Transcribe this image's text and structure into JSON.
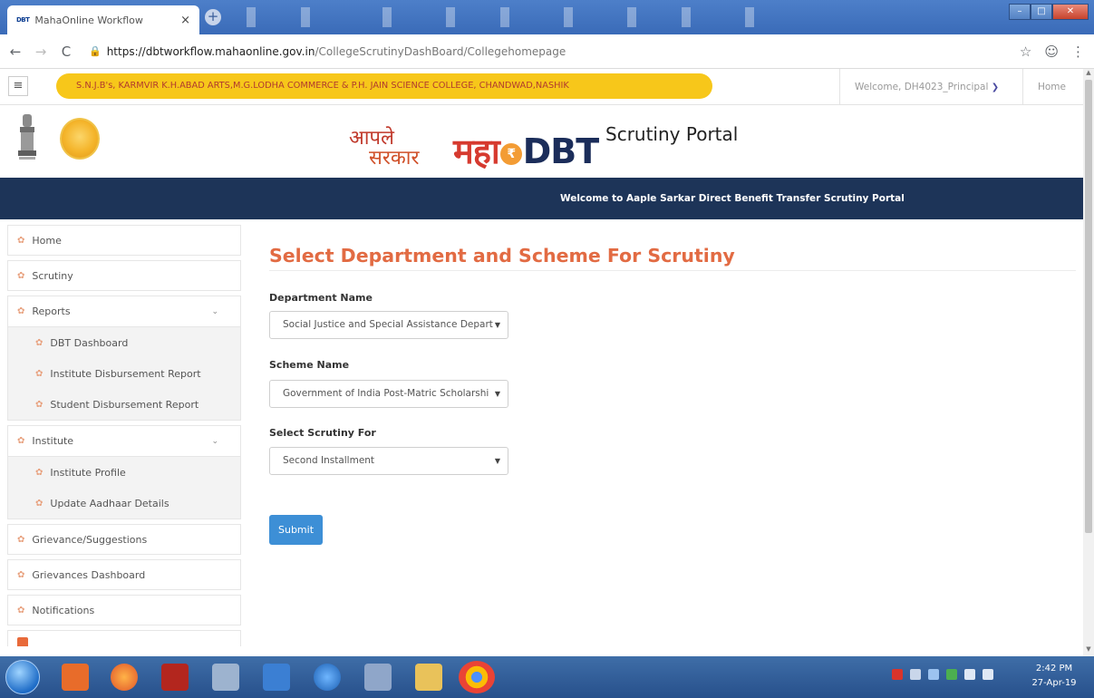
{
  "browser": {
    "tab_favicon": "DBT",
    "tab_title": "MahaOnline Workflow",
    "tab_close": "×",
    "new_tab": "+",
    "url_host": "https://dbtworkflow.mahaonline.gov.in",
    "url_path": "/CollegeScrutinyDashBoard/Collegehomepage"
  },
  "topbar": {
    "college_name": "S.N.J.B's, KARMVIR K.H.ABAD ARTS,M.G.LODHA COMMERCE & P.H. JAIN SCIENCE COLLEGE, CHANDWAD,NASHIK",
    "welcome_user": "Welcome, DH4023_Principal",
    "home_link": "Home"
  },
  "header": {
    "aaple_line1": "आपले",
    "aaple_line2": "सरकार",
    "maha_text": "महा",
    "rupee": "₹",
    "dbt_text": "DBT",
    "portal_title": "Scrutiny Portal"
  },
  "banner": {
    "text": "Welcome to Aaple Sarkar Direct Benefit Transfer Scrutiny Portal"
  },
  "sidebar": {
    "home": "Home",
    "scrutiny": "Scrutiny",
    "reports": {
      "label": "Reports",
      "items": [
        "DBT Dashboard",
        "Institute Disbursement Report",
        "Student Disbursement Report"
      ]
    },
    "institute": {
      "label": "Institute",
      "items": [
        "Institute Profile",
        "Update Aadhaar Details"
      ]
    },
    "grievance_suggestions": "Grievance/Suggestions",
    "grievances_dashboard": "Grievances Dashboard",
    "notifications": "Notifications"
  },
  "main": {
    "page_title": "Select Department and Scheme For Scrutiny",
    "department": {
      "label": "Department Name",
      "selected": "Social Justice and Special Assistance Depart"
    },
    "scheme": {
      "label": "Scheme Name",
      "selected": "Government of India Post-Matric Scholarshi"
    },
    "scrutiny_for": {
      "label": "Select Scrutiny For",
      "selected": "Second Installment"
    },
    "submit_label": "Submit"
  },
  "taskbar": {
    "time": "2:42 PM",
    "date": "27-Apr-19"
  },
  "colors": {
    "accent_title": "#e26b43",
    "college_pill": "#f7c71a",
    "banner_navy": "#1d3458",
    "submit_blue": "#3d8fd6"
  }
}
